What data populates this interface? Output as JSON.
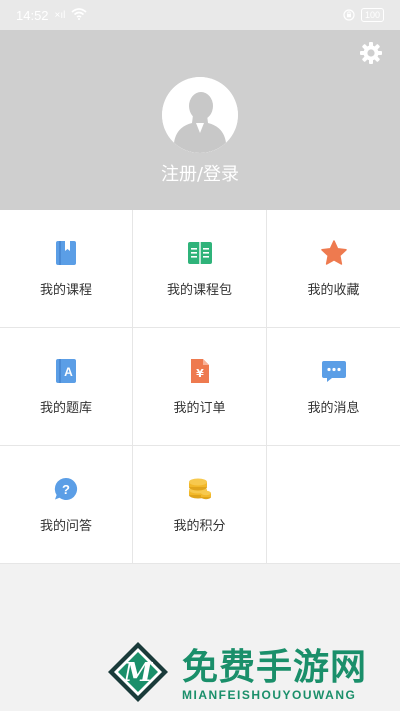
{
  "status_bar": {
    "time": "14:52",
    "signal_label": "×ıl",
    "battery": "100"
  },
  "header": {
    "login_label": "注册/登录"
  },
  "menu": {
    "items": [
      {
        "label": "我的课程",
        "icon": "bookmark-book-icon",
        "color": "#5b9ee6"
      },
      {
        "label": "我的课程包",
        "icon": "open-book-icon",
        "color": "#2fb37a"
      },
      {
        "label": "我的收藏",
        "icon": "star-icon",
        "color": "#ee7a4f"
      },
      {
        "label": "我的题库",
        "icon": "question-bank-icon",
        "color": "#5b9ee6"
      },
      {
        "label": "我的订单",
        "icon": "order-document-icon",
        "color": "#ee7a4f"
      },
      {
        "label": "我的消息",
        "icon": "chat-bubble-icon",
        "color": "#5b9ee6"
      },
      {
        "label": "我的问答",
        "icon": "question-bubble-icon",
        "color": "#5b9ee6"
      },
      {
        "label": "我的积分",
        "icon": "coins-icon",
        "color": "#f2b829"
      }
    ]
  },
  "watermark": {
    "title": "免费手游网",
    "subtitle": "MIANFEISHOUYOUWANG",
    "logo_letter": "M"
  }
}
